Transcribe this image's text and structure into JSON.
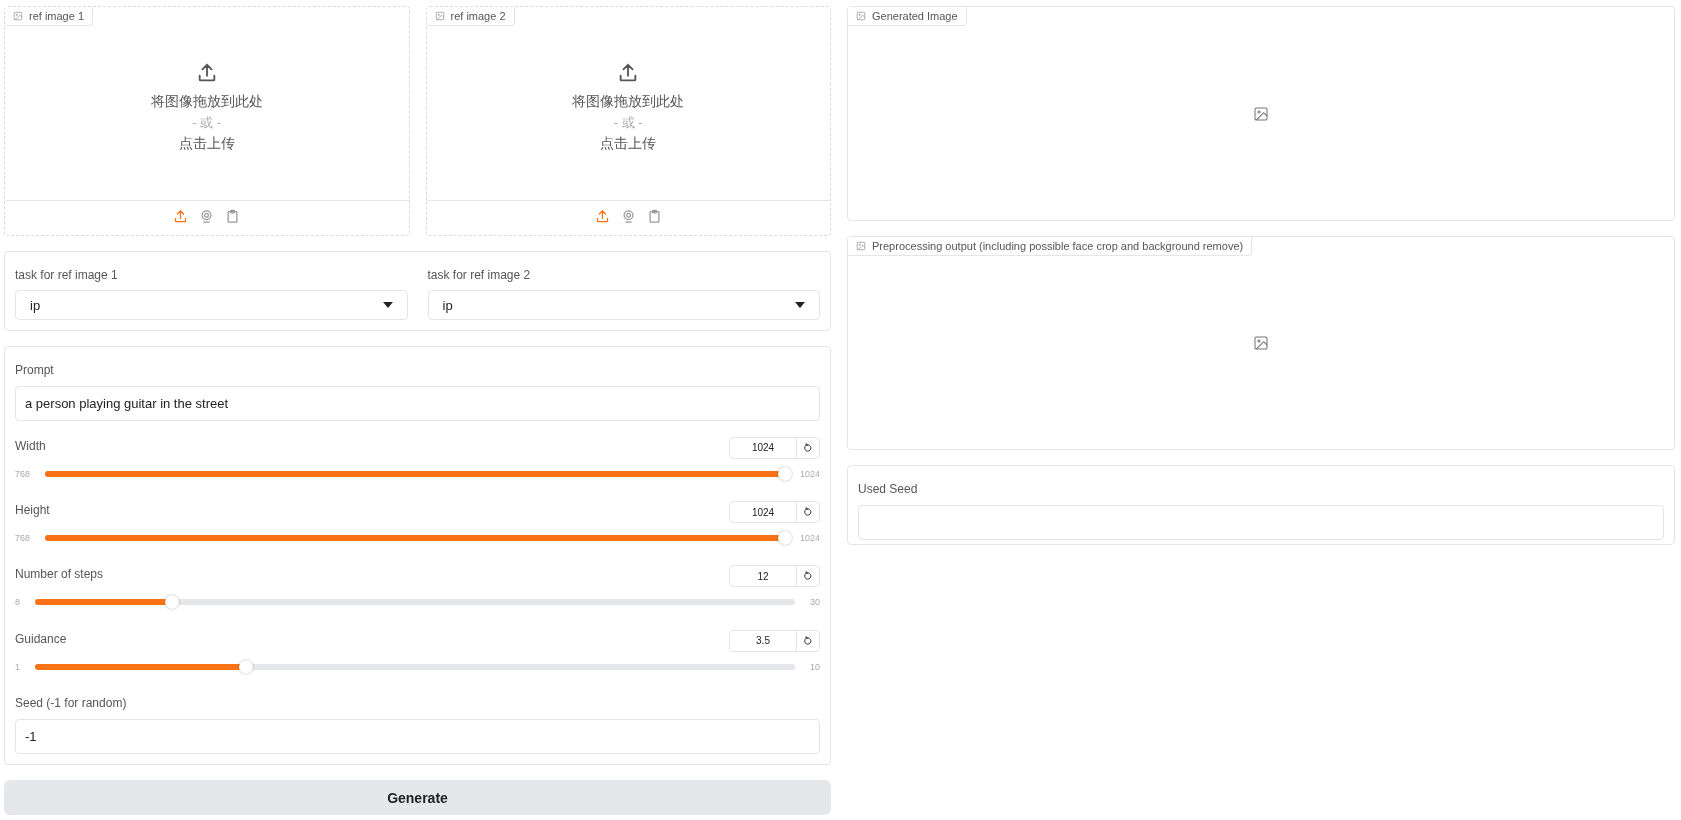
{
  "ref_images": [
    {
      "label": "ref image 1",
      "drop_text": "将图像拖放到此处",
      "or_text": "- 或 -",
      "click_text": "点击上传",
      "sources": [
        {
          "kind": "upload",
          "selected": true
        },
        {
          "kind": "webcam",
          "selected": false
        },
        {
          "kind": "clipboard",
          "selected": false
        }
      ]
    },
    {
      "label": "ref image 2",
      "drop_text": "将图像拖放到此处",
      "or_text": "- 或 -",
      "click_text": "点击上传",
      "sources": [
        {
          "kind": "upload",
          "selected": true
        },
        {
          "kind": "webcam",
          "selected": false
        },
        {
          "kind": "clipboard",
          "selected": false
        }
      ]
    }
  ],
  "tasks": [
    {
      "label": "task for ref image 1",
      "value": "ip"
    },
    {
      "label": "task for ref image 2",
      "value": "ip"
    }
  ],
  "prompt": {
    "label": "Prompt",
    "value": "a person playing guitar in the street"
  },
  "sliders": [
    {
      "label": "Width",
      "value": "1024",
      "min": "768",
      "max": "1024",
      "level": 1.0
    },
    {
      "label": "Height",
      "value": "1024",
      "min": "768",
      "max": "1024",
      "level": 1.0
    },
    {
      "label": "Number of steps",
      "value": "12",
      "min": "8",
      "max": "30",
      "level": 0.18
    },
    {
      "label": "Guidance",
      "value": "3.5",
      "min": "1",
      "max": "10",
      "level": 0.278
    }
  ],
  "seed": {
    "label": "Seed (-1 for random)",
    "value": "-1"
  },
  "generate_button": "Generate",
  "outputs": [
    {
      "label": "Generated Image"
    },
    {
      "label": "Preprocessing output (including possible face crop and background remove)"
    }
  ],
  "used_seed": {
    "label": "Used Seed"
  }
}
